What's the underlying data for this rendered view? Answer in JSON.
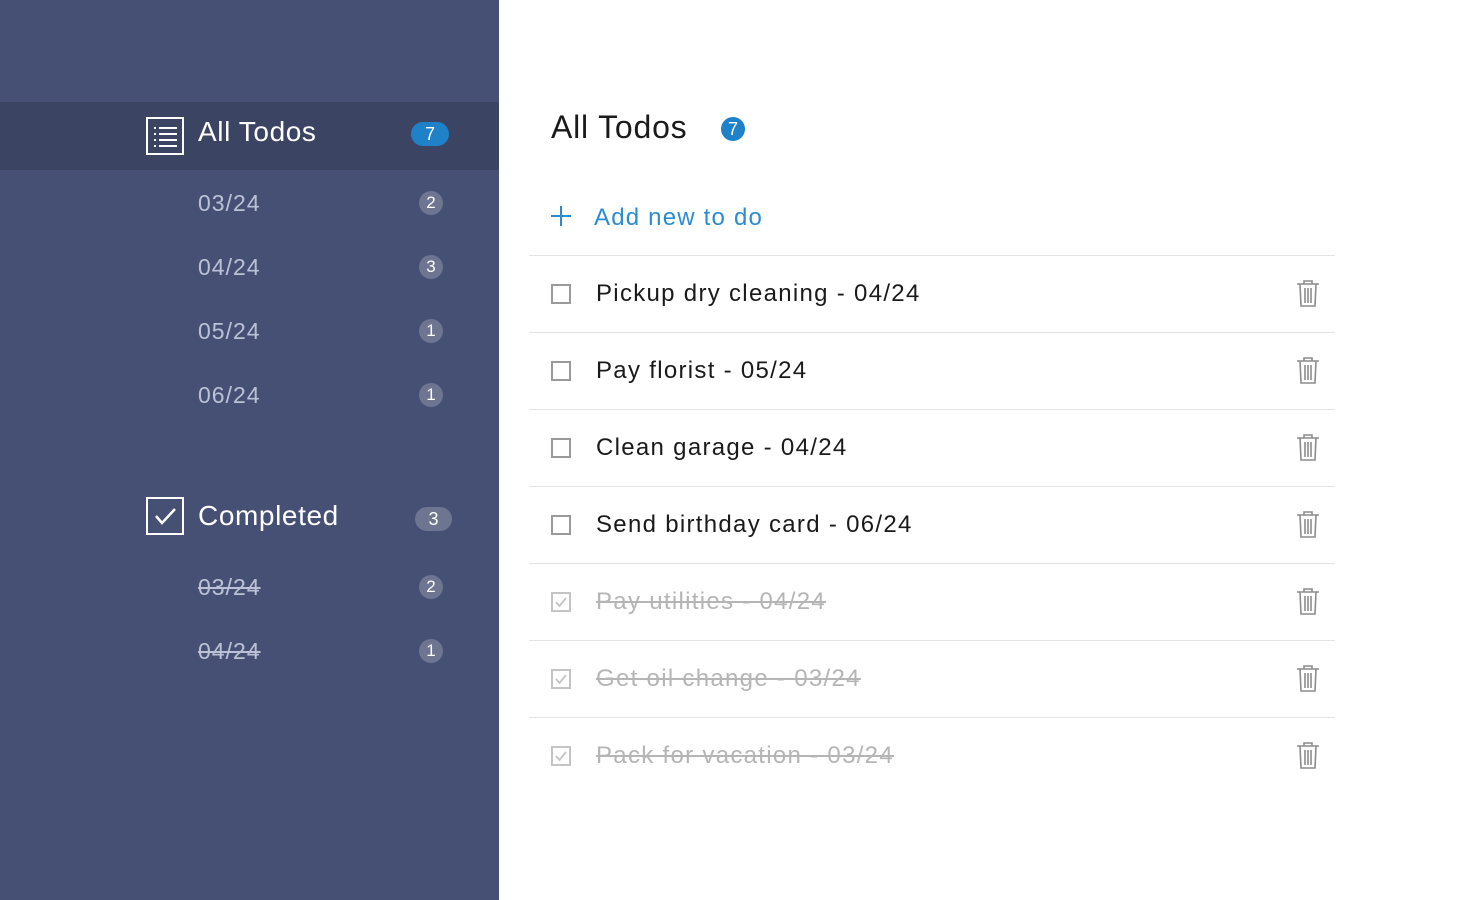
{
  "colors": {
    "sidebar_bg": "#465075",
    "sidebar_active_bg": "#3c4464",
    "accent_blue": "#1f82c8",
    "link_blue": "#2b8cd3",
    "muted_badge": "#6d7591"
  },
  "sidebar": {
    "all_todos": {
      "icon": "list-icon",
      "label": "All Todos",
      "count": "7",
      "dates": [
        {
          "label": "03/24",
          "count": "2"
        },
        {
          "label": "04/24",
          "count": "3"
        },
        {
          "label": "05/24",
          "count": "1"
        },
        {
          "label": "06/24",
          "count": "1"
        }
      ]
    },
    "completed": {
      "icon": "checkbox-checked-icon",
      "label": "Completed",
      "count": "3",
      "dates": [
        {
          "label": "03/24",
          "count": "2"
        },
        {
          "label": "04/24",
          "count": "1"
        }
      ]
    }
  },
  "main": {
    "title": "All Todos",
    "count": "7",
    "add_label": "Add new to do",
    "add_icon": "plus-icon",
    "delete_icon": "trash-icon",
    "todos": [
      {
        "text": "Pickup dry cleaning - 04/24",
        "completed": false
      },
      {
        "text": "Pay florist - 05/24",
        "completed": false
      },
      {
        "text": "Clean garage - 04/24",
        "completed": false
      },
      {
        "text": "Send birthday card - 06/24",
        "completed": false
      },
      {
        "text": "Pay utilities - 04/24",
        "completed": true
      },
      {
        "text": "Get oil change - 03/24",
        "completed": true
      },
      {
        "text": "Pack for vacation - 03/24",
        "completed": true
      }
    ]
  }
}
